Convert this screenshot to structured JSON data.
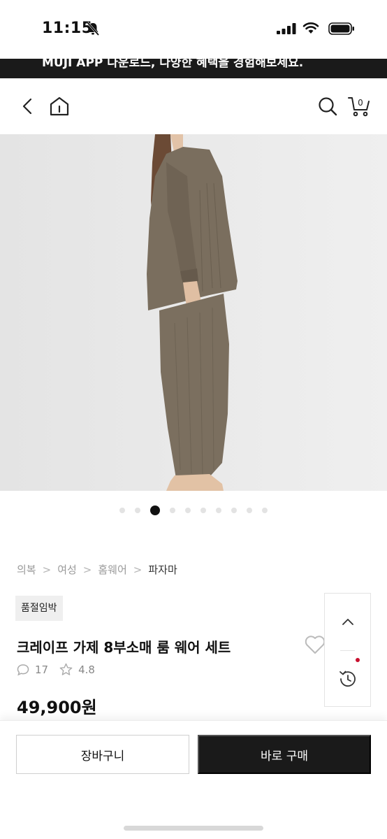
{
  "status_bar": {
    "time": "11:15"
  },
  "banner": {
    "text": "MUJI APP 다운로드, 다양한 혜택을 경험해보세요."
  },
  "carousel": {
    "total": 10,
    "active_index": 2
  },
  "breadcrumb": {
    "items": [
      "의복",
      "여성",
      "홈웨어",
      "파자마"
    ]
  },
  "product": {
    "badge": "품절임박",
    "name": "크레이프 가제 8부소매 룸 웨어 세트",
    "review_count": "17",
    "rating": "4.8",
    "price": "49,900원"
  },
  "actions": {
    "cart_label": "장바구니",
    "buy_label": "바로 구매"
  },
  "colors": {
    "accent": "#1a1a1a",
    "garment": "#7a6e5e",
    "notification": "#c8102e"
  },
  "icons": [
    "bell-slash-icon",
    "signal-icon",
    "wifi-icon",
    "battery-icon",
    "back-icon",
    "home-icon",
    "search-icon",
    "cart-icon",
    "heart-icon",
    "comment-icon",
    "star-icon",
    "chevron-up-icon",
    "history-icon"
  ]
}
